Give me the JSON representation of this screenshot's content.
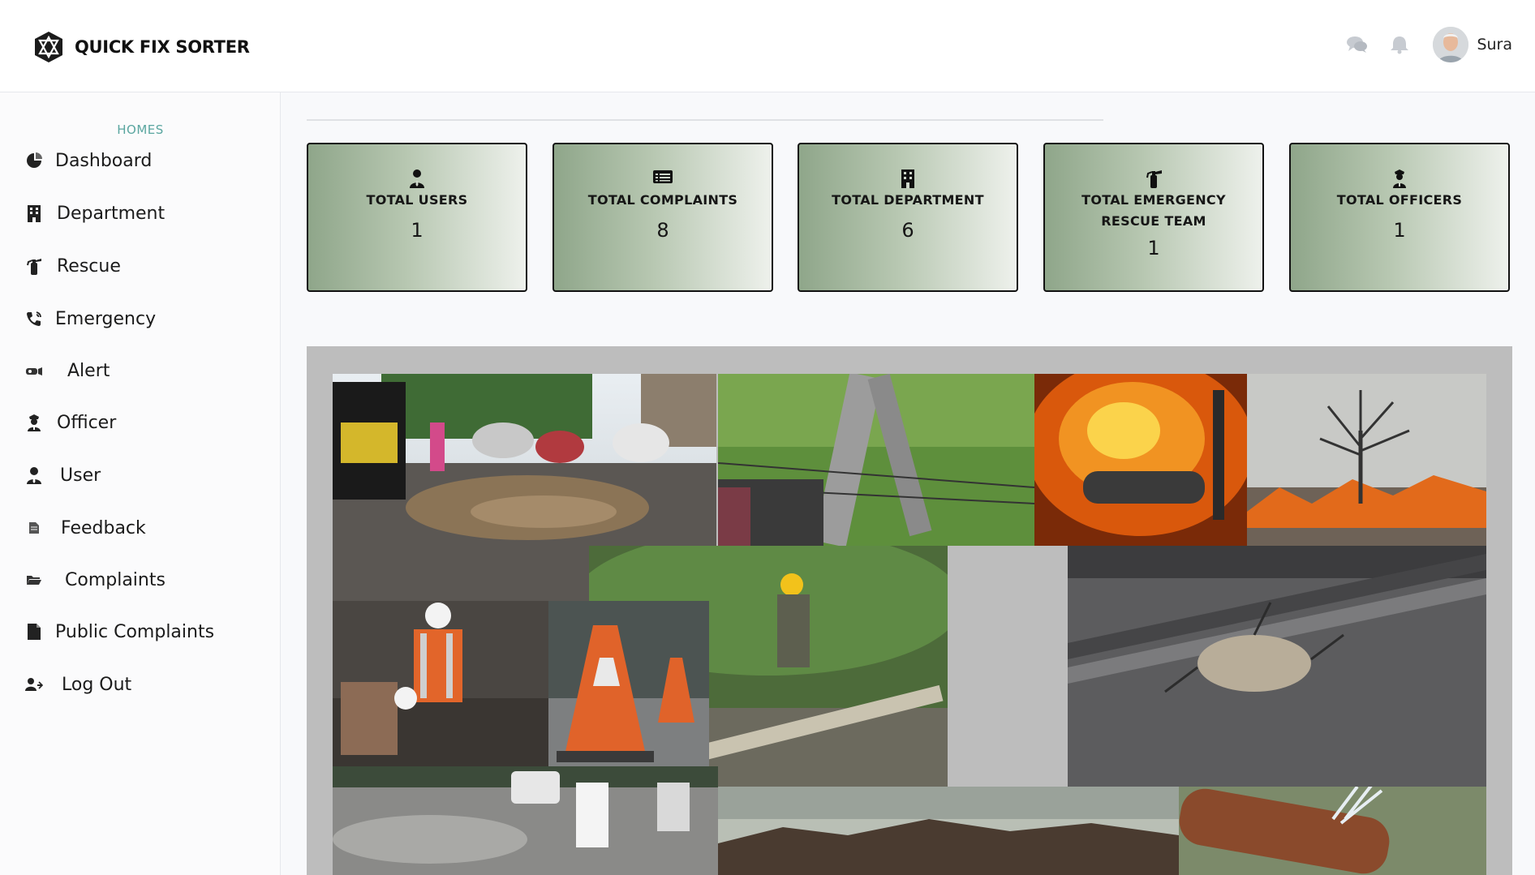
{
  "app": {
    "brand_name": "QUICK FIX SORTER",
    "username": "Sura",
    "colors": {
      "accent_teal": "#5aa6a0",
      "card_gradient_start": "#8fa68a",
      "card_gradient_end": "#eef1ec"
    }
  },
  "header": {
    "icons": [
      "chat-icon",
      "notification-bell-icon"
    ]
  },
  "sidebar": {
    "heading": "HOMES",
    "items": [
      {
        "label": "Dashboard",
        "icon": "pie-chart-icon"
      },
      {
        "label": "Department",
        "icon": "building-icon"
      },
      {
        "label": "Rescue",
        "icon": "fire-extinguisher-icon"
      },
      {
        "label": "Emergency",
        "icon": "phone-call-icon"
      },
      {
        "label": "Alert",
        "icon": "siren-icon"
      },
      {
        "label": "Officer",
        "icon": "officer-icon"
      },
      {
        "label": "User",
        "icon": "user-icon"
      },
      {
        "label": "Feedback",
        "icon": "document-icon"
      },
      {
        "label": "Complaints",
        "icon": "folder-open-icon"
      },
      {
        "label": "Public Complaints",
        "icon": "file-icon"
      },
      {
        "label": "Log Out",
        "icon": "user-logout-icon"
      }
    ]
  },
  "stats": [
    {
      "title": "TOTAL USERS",
      "value": "1",
      "icon": "user-icon"
    },
    {
      "title": "TOTAL COMPLAINTS",
      "value": "8",
      "icon": "list-card-icon"
    },
    {
      "title": "TOTAL DEPARTMENT",
      "value": "6",
      "icon": "building-icon"
    },
    {
      "title_line1": "TOTAL EMERGENCY",
      "title_line2": "RESCUE TEAM",
      "value": "1",
      "icon": "fire-extinguisher-icon"
    },
    {
      "title": "TOTAL OFFICERS",
      "value": "1",
      "icon": "officer-icon"
    }
  ]
}
